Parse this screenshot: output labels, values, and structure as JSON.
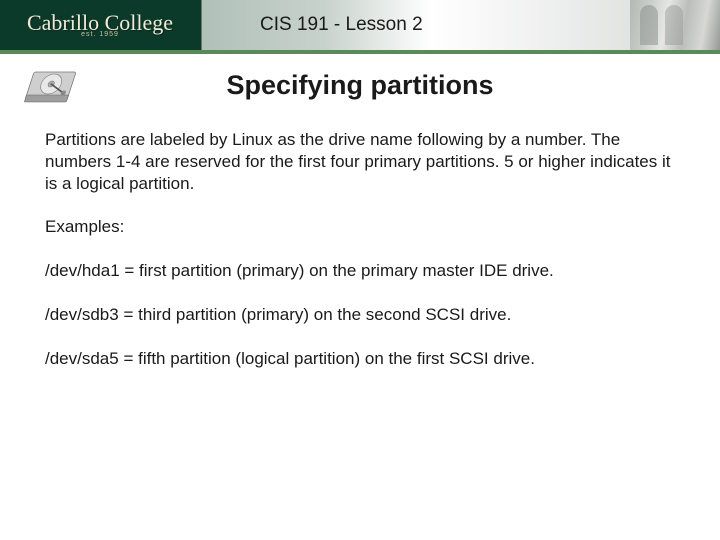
{
  "banner": {
    "logo_text": "Cabrillo College",
    "logo_est": "est. 1959",
    "course_title": "CIS 191 - Lesson 2"
  },
  "slide": {
    "title": "Specifying partitions",
    "intro": "Partitions are labeled by Linux as the drive name following by a number.  The numbers 1-4 are reserved for the first four primary partitions.  5 or higher indicates it is a logical partition.",
    "examples_label": "Examples:",
    "ex1": "/dev/hda1 = first partition (primary) on the primary master IDE drive.",
    "ex2": "/dev/sdb3 = third partition (primary) on the second SCSI drive.",
    "ex3": "/dev/sda5 = fifth partition (logical partition) on the first SCSI drive."
  }
}
